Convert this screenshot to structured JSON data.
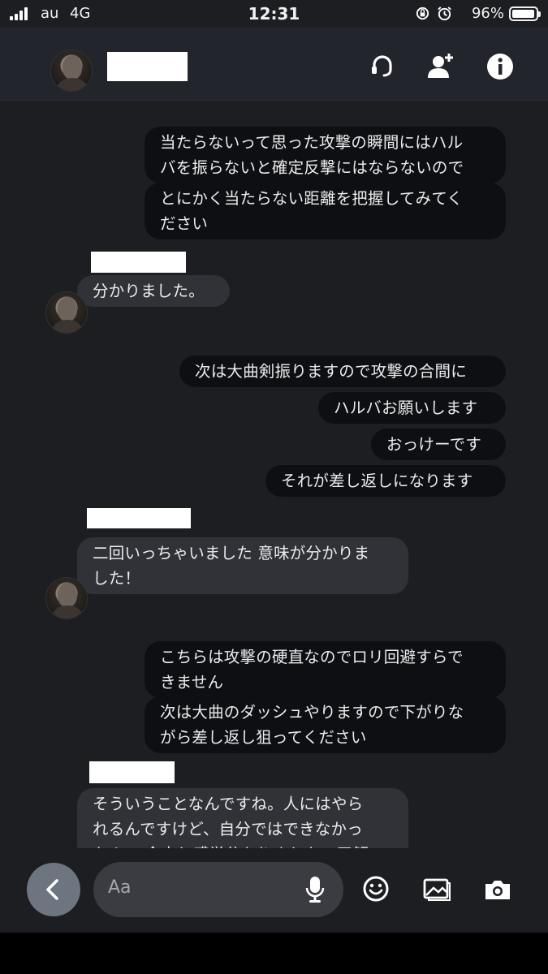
{
  "status_bar": {
    "carrier": "au",
    "network": "4G",
    "time": "12:31",
    "battery_percent": "96%",
    "battery_level": 0.96
  },
  "header": {
    "icons": [
      "headset-icon",
      "add-person-icon",
      "info-icon"
    ]
  },
  "messages": [
    {
      "side": "out",
      "lines": [
        "当たらないって思った攻撃の瞬間にはハル",
        "バを振らないと確定反撃にはならないので"
      ]
    },
    {
      "side": "out",
      "lines": [
        "とにかく当たらない距離を把握してみてく",
        "ださい"
      ]
    },
    {
      "side": "in",
      "lines": [
        "分かりました。"
      ]
    },
    {
      "side": "out",
      "lines": [
        "次は大曲剣振りますので攻撃の合間に"
      ]
    },
    {
      "side": "out",
      "lines": [
        "ハルバお願いします"
      ]
    },
    {
      "side": "out",
      "lines": [
        "おっけーです"
      ]
    },
    {
      "side": "out",
      "lines": [
        "それが差し返しになります"
      ]
    },
    {
      "side": "in",
      "lines": [
        "二回いっちゃいました 意味が分かりま",
        "した！"
      ]
    },
    {
      "side": "out",
      "lines": [
        "こちらは攻撃の硬直なのでロリ回避すらで",
        "きません"
      ]
    },
    {
      "side": "out",
      "lines": [
        "次は大曲のダッシュやりますので下がりな",
        "がら差し返し狙ってください"
      ]
    },
    {
      "side": "in",
      "lines": [
        "そういうことなんですね。人にはやら",
        "れるんですけど、自分ではできなかっ",
        "たんで 今少し感覚分かりました。了解"
      ]
    }
  ],
  "composer": {
    "placeholder": "Aa",
    "icons": [
      "back-chevron-icon",
      "microphone-icon",
      "emoji-icon",
      "gallery-icon",
      "camera-icon"
    ]
  }
}
